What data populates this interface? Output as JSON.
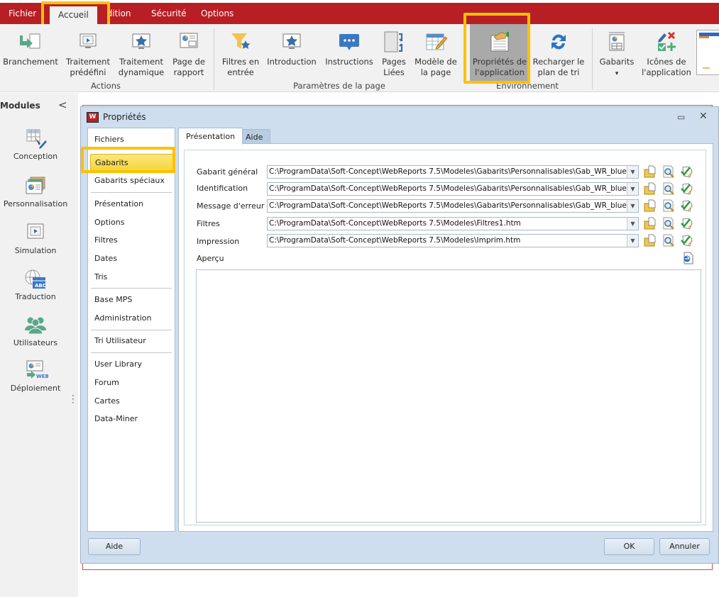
{
  "menu": {
    "tabs": [
      {
        "label": "Fichier"
      },
      {
        "label": "Accueil",
        "active": true
      },
      {
        "label": "Edition"
      },
      {
        "label": "Sécurité"
      },
      {
        "label": "Options"
      }
    ]
  },
  "ribbon": {
    "groups": [
      {
        "label": "Actions"
      },
      {
        "label": "Paramètres de la page"
      },
      {
        "label": "Environnement"
      }
    ],
    "buttons": [
      {
        "label": "Branchement",
        "icon": "branch-arrow-icon"
      },
      {
        "label": "Traitement prédéfini",
        "icon": "monitor-play-icon"
      },
      {
        "label": "Traitement dynamique",
        "icon": "monitor-star-icon"
      },
      {
        "label": "Page de rapport",
        "icon": "report-page-icon"
      },
      {
        "label": "Filtres en entrée",
        "icon": "funnel-star-icon"
      },
      {
        "label": "Introduction",
        "icon": "monitor-star-icon"
      },
      {
        "label": "Instructions",
        "icon": "speech-bubble-icon"
      },
      {
        "label": "Pages Liées",
        "icon": "linked-pages-icon"
      },
      {
        "label": "Modèle de la page",
        "icon": "page-template-pencil-icon"
      },
      {
        "label": "Propriétés de l'application",
        "icon": "app-properties-icon",
        "selected": true
      },
      {
        "label": "Recharger le plan de tri",
        "icon": "refresh-icon"
      },
      {
        "label": "Gabarits",
        "icon": "templates-icon",
        "dropdown": "▾"
      },
      {
        "label": "Icônes de l'application",
        "icon": "app-icons-icon"
      }
    ]
  },
  "modules": {
    "title": "Modules",
    "collapse": "<",
    "items": [
      {
        "label": "Conception",
        "icon": "grid-pencil-icon"
      },
      {
        "label": "Personnalisation",
        "icon": "cards-chart-icon"
      },
      {
        "label": "Simulation",
        "icon": "monitor-play-icon"
      },
      {
        "label": "Traduction",
        "icon": "globe-abc-icon"
      },
      {
        "label": "Utilisateurs",
        "icon": "users-icon"
      },
      {
        "label": "Déploiement",
        "icon": "web-deploy-icon"
      }
    ]
  },
  "dialog": {
    "title": "Propriétés",
    "app_icon_letter": "W",
    "sidebar": {
      "items": [
        {
          "label": "Fichiers"
        },
        {
          "label": "Gabarits",
          "selected": true
        },
        {
          "label": "Gabarits spéciaux"
        },
        {
          "label": "Présentation"
        },
        {
          "label": "Options"
        },
        {
          "label": "Filtres"
        },
        {
          "label": "Dates"
        },
        {
          "label": "Tris"
        },
        {
          "label": "Base MPS"
        },
        {
          "label": "Administration"
        },
        {
          "label": "Tri Utilisateur"
        },
        {
          "label": "User Library"
        },
        {
          "label": "Forum"
        },
        {
          "label": "Cartes"
        },
        {
          "label": "Data-Miner"
        }
      ]
    },
    "tabs": [
      {
        "label": "Présentation",
        "active": true
      },
      {
        "label": "Aide"
      }
    ],
    "fields": [
      {
        "label": "Gabarit général",
        "value": "C:\\ProgramData\\Soft-Concept\\WebReports 7.5\\Modeles\\Gabarits\\Personnalisables\\Gab_WR_bluetown"
      },
      {
        "label": "Identification",
        "value": "C:\\ProgramData\\Soft-Concept\\WebReports 7.5\\Modeles\\Gabarits\\Personnalisables\\Gab_WR_bluetown"
      },
      {
        "label": "Message d'erreur",
        "value": "C:\\ProgramData\\Soft-Concept\\WebReports 7.5\\Modeles\\Gabarits\\Personnalisables\\Gab_WR_bluetown"
      },
      {
        "label": "Filtres",
        "value": "C:\\ProgramData\\Soft-Concept\\WebReports 7.5\\Modeles\\Filtres1.htm"
      },
      {
        "label": "Impression",
        "value": "C:\\ProgramData\\Soft-Concept\\WebReports 7.5\\Modeles\\Imprim.htm"
      }
    ],
    "preview_label": "Aperçu",
    "buttons": {
      "help": "Aide",
      "ok": "OK",
      "cancel": "Annuler"
    }
  }
}
